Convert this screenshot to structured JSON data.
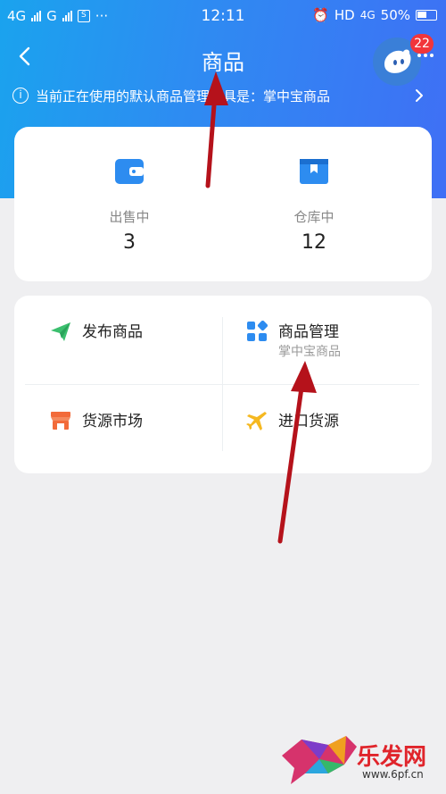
{
  "status_bar": {
    "network_left": "4G",
    "network_mid": "G",
    "time": "12:11",
    "hd": "HD",
    "network_right": "4G",
    "battery": "50%"
  },
  "nav": {
    "title": "商品",
    "badge_count": "22"
  },
  "notice": {
    "text": "当前正在使用的默认商品管理工具是：掌中宝商品"
  },
  "stats": [
    {
      "label": "出售中",
      "value": "3"
    },
    {
      "label": "仓库中",
      "value": "12"
    }
  ],
  "tools": [
    {
      "label": "发布商品",
      "sub": ""
    },
    {
      "label": "商品管理",
      "sub": "掌中宝商品"
    },
    {
      "label": "货源市场",
      "sub": ""
    },
    {
      "label": "进口货源",
      "sub": ""
    }
  ],
  "watermark": {
    "text": "乐发网",
    "url": "www.6pf.cn"
  },
  "colors": {
    "accent": "#2f8af2",
    "icon_blue": "#2d8cf0",
    "icon_green": "#3bbf6e",
    "icon_orange": "#f26b3a",
    "icon_yellow": "#f5b820",
    "annotation_arrow": "#b5121b",
    "badge": "#f2353a"
  }
}
